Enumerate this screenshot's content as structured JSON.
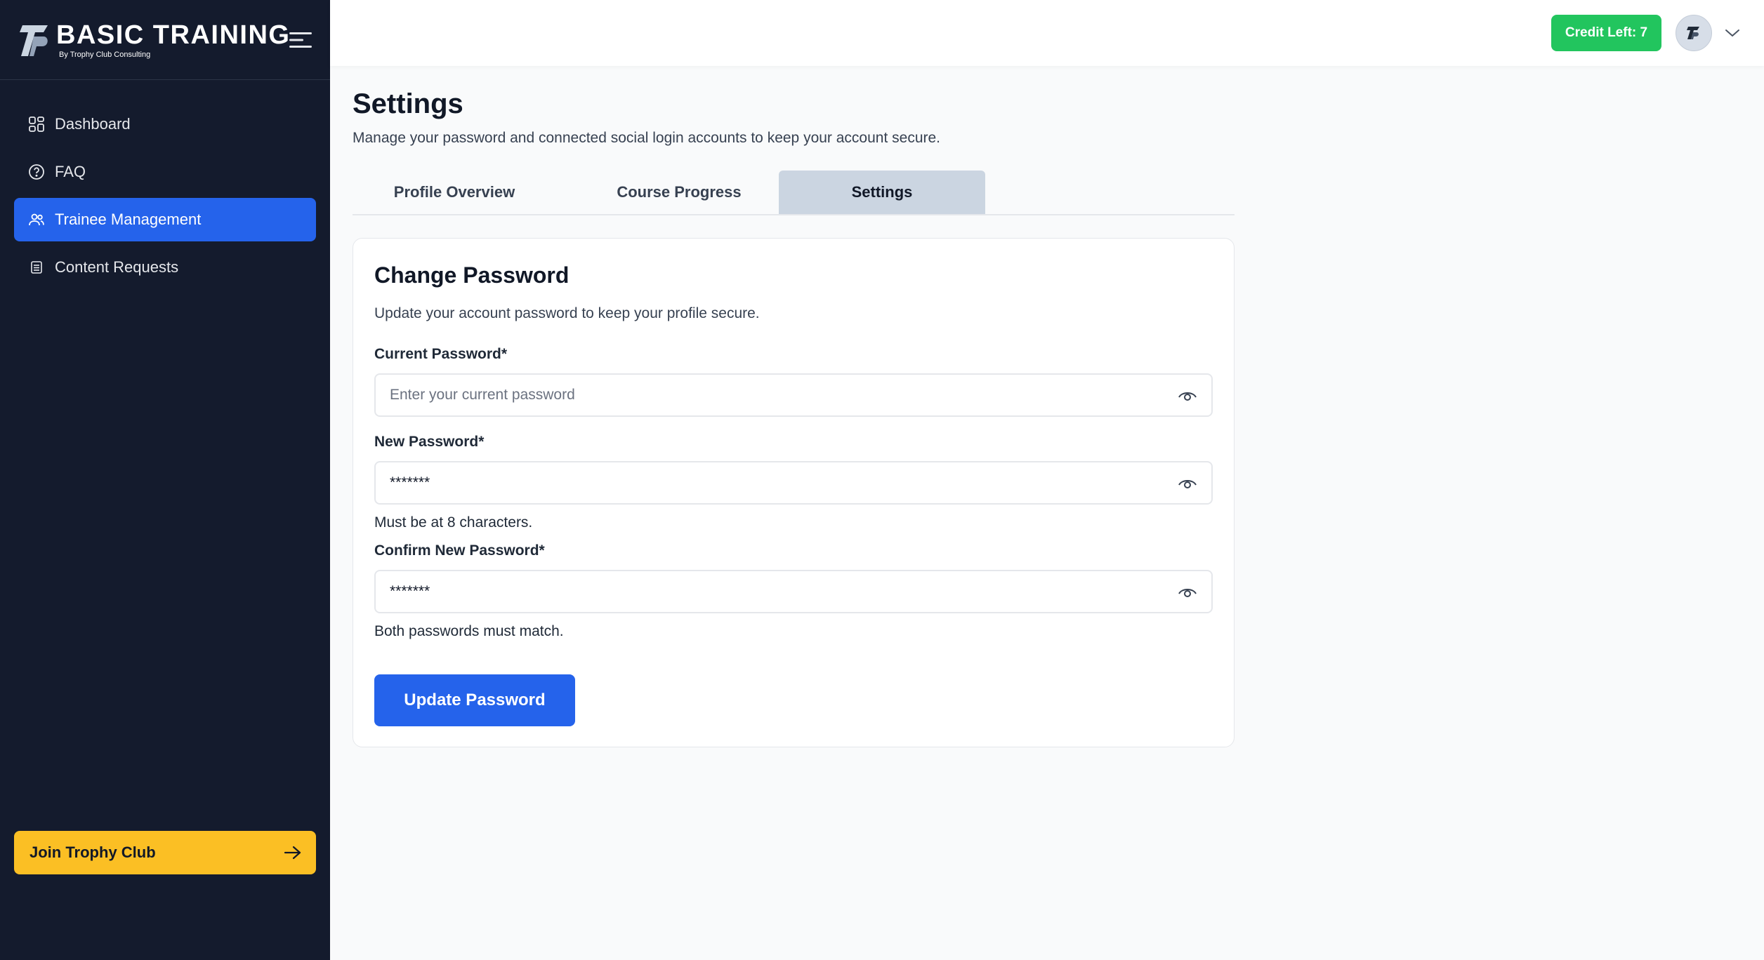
{
  "brand": {
    "title": "BASIC TRAINING",
    "subtitle": "By Trophy Club Consulting"
  },
  "sidebar": {
    "items": [
      {
        "label": "Dashboard",
        "icon": "grid-icon",
        "active": false
      },
      {
        "label": "FAQ",
        "icon": "question-circle-icon",
        "active": false
      },
      {
        "label": "Trainee Management",
        "icon": "users-icon",
        "active": true
      },
      {
        "label": "Content Requests",
        "icon": "database-icon",
        "active": false
      }
    ],
    "join_label": "Join Trophy Club"
  },
  "topbar": {
    "credit_label": "Credit Left: 7"
  },
  "page": {
    "title": "Settings",
    "subtitle": "Manage your password and connected social login accounts to keep your account secure."
  },
  "tabs": [
    {
      "label": "Profile Overview",
      "active": false
    },
    {
      "label": "Course Progress",
      "active": false
    },
    {
      "label": "Settings",
      "active": true
    }
  ],
  "change_password": {
    "title": "Change Password",
    "subtitle": "Update your account password to keep your profile secure.",
    "current": {
      "label": "Current Password*",
      "placeholder": "Enter your current password",
      "value": ""
    },
    "new": {
      "label": "New Password*",
      "value": "*******",
      "hint": "Must be at 8 characters."
    },
    "confirm": {
      "label": "Confirm New Password*",
      "value": "*******",
      "hint": "Both passwords must match."
    },
    "submit_label": "Update Password"
  },
  "colors": {
    "sidebar_bg": "#141b2d",
    "accent": "#2563eb",
    "credit": "#22c55e",
    "join": "#fbbf24"
  }
}
